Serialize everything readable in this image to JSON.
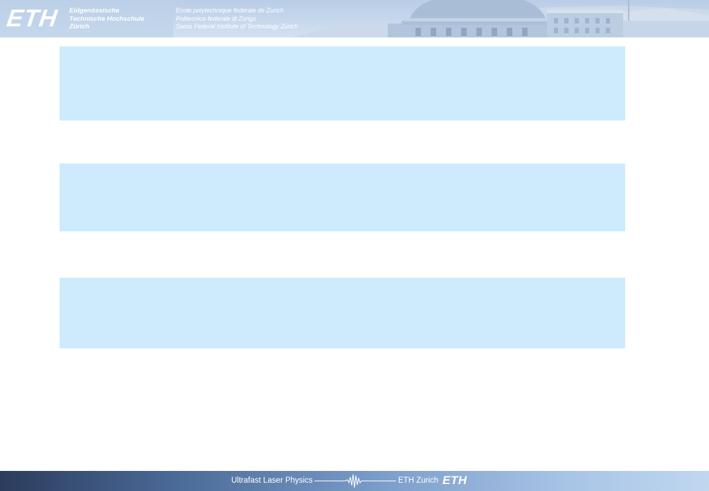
{
  "header": {
    "logo_text": "ETH",
    "name_de": [
      "Eidgenössische",
      "Technische Hochschule",
      "Zürich"
    ],
    "name_intl": [
      "Ecole polytechnique fédérale de Zurich",
      "Politecnico federale di Zurigo",
      "Swiss Federal Institute of Technology Zurich"
    ],
    "illustration": "eth-main-building-dome-photo"
  },
  "content": {
    "boxes": [
      {
        "text": ""
      },
      {
        "text": ""
      },
      {
        "text": ""
      }
    ]
  },
  "footer": {
    "title": "Ultrafast Laser Physics",
    "affiliation": "ETH Zurich",
    "logo_text": "ETH",
    "wave_icon": "laser-pulse-waveform-icon"
  },
  "colors": {
    "box_fill": "#cdebfc",
    "header_bg": "#c8d9ee",
    "footer_dark": "#2c3c5c",
    "footer_light": "#c0d7ef",
    "text_on_dark": "#ffffff"
  }
}
